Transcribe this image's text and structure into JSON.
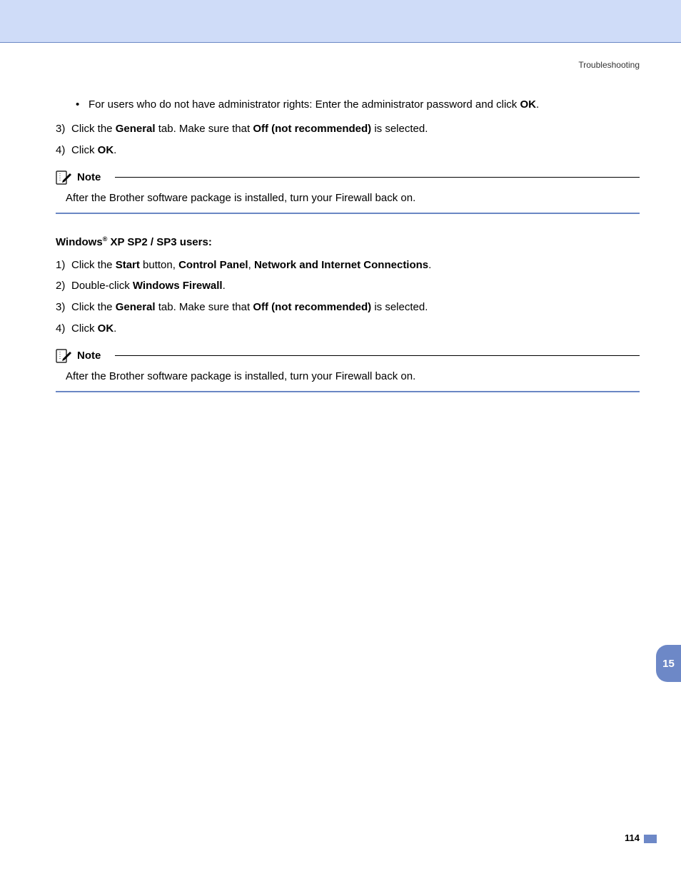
{
  "header": {
    "section": "Troubleshooting"
  },
  "bullet1": {
    "pre": "For users who do not have administrator rights: Enter the administrator password and click ",
    "bold": "OK",
    "post": "."
  },
  "step3a": {
    "num": "3)",
    "t1": "Click the ",
    "b1": "General",
    "t2": " tab. Make sure that ",
    "b2": "Off (not recommended)",
    "t3": " is selected."
  },
  "step4a": {
    "num": "4)",
    "t1": "Click ",
    "b1": "OK",
    "t2": "."
  },
  "note1": {
    "label": "Note",
    "body": "After the Brother software package is installed, turn your Firewall back on."
  },
  "heading_xp": {
    "t1": "Windows",
    "reg": "®",
    "t2": " XP SP2 / SP3 users:"
  },
  "xp1": {
    "num": "1)",
    "t1": "Click the ",
    "b1": "Start",
    "t2": " button, ",
    "b2": "Control Panel",
    "t3": ", ",
    "b3": "Network and Internet Connections",
    "t4": "."
  },
  "xp2": {
    "num": "2)",
    "t1": "Double-click ",
    "b1": "Windows Firewall",
    "t2": "."
  },
  "xp3": {
    "num": "3)",
    "t1": "Click the ",
    "b1": "General",
    "t2": " tab. Make sure that ",
    "b2": "Off (not recommended)",
    "t3": " is selected."
  },
  "xp4": {
    "num": "4)",
    "t1": "Click ",
    "b1": "OK",
    "t2": "."
  },
  "note2": {
    "label": "Note",
    "body": "After the Brother software package is installed, turn your Firewall back on."
  },
  "chapter_tab": "15",
  "page_number": "114"
}
